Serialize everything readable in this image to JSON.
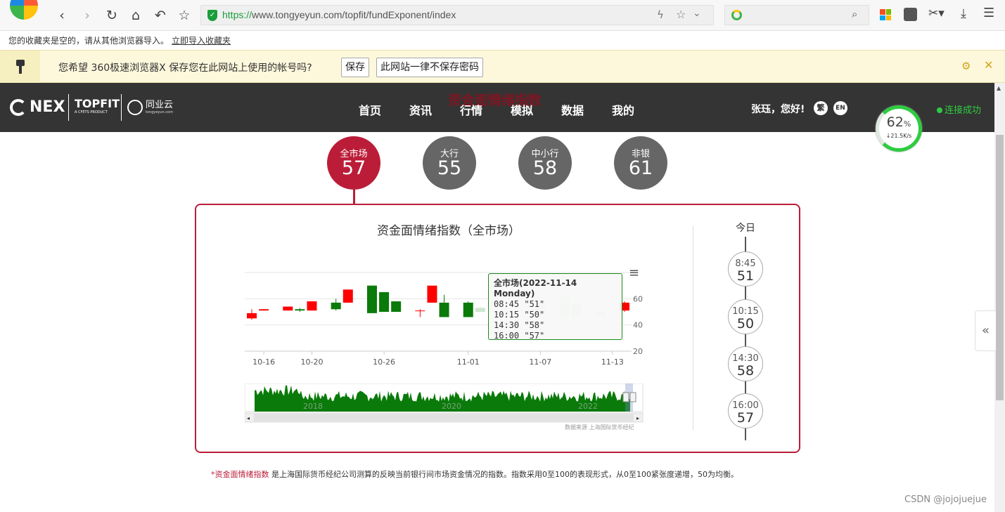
{
  "browser": {
    "url_scheme": "https://",
    "url_rest": "www.tongyeyun.com/topfit/fundExponent/index",
    "bookmark_empty_text": "您的收藏夹是空的，请从其他浏览器导入。",
    "bookmark_import_link": "立即导入收藏夹"
  },
  "password_bar": {
    "prompt": "您希望 360极速浏览器X 保存您在此网站上使用的帐号吗?",
    "save_label": "保存",
    "never_label": "此网站一律不保存密码"
  },
  "site": {
    "logo_nex": "NEX",
    "logo_topfit": "TOPFIT",
    "logo_topfit_sub": "A CFETS PRODUCT",
    "logo_tyy": "同业云",
    "logo_tyy_sub": "tongyeyun.com",
    "overlay_title": "资金面情绪指数",
    "nav": [
      "首页",
      "资讯",
      "行情",
      "模拟",
      "数据",
      "我的"
    ],
    "greeting": "张珏，您好!",
    "lang_trad": "繁",
    "lang_en": "EN",
    "connection": "连接成功",
    "speed_percent": "62",
    "speed_unit": "%",
    "speed_rate": "↓21.5K/s"
  },
  "circles": [
    {
      "label": "全市场",
      "value": "57",
      "active": true
    },
    {
      "label": "大行",
      "value": "55",
      "active": false
    },
    {
      "label": "中小行",
      "value": "58",
      "active": false
    },
    {
      "label": "非银",
      "value": "61",
      "active": false
    }
  ],
  "panel": {
    "chart_title": "资金面情绪指数（全市场）",
    "source_note": "数据来源 上海国际货币经纪",
    "today_label": "今日",
    "timeline": [
      {
        "time": "8:45",
        "value": "51"
      },
      {
        "time": "10:15",
        "value": "50"
      },
      {
        "time": "14:30",
        "value": "58"
      },
      {
        "time": "16:00",
        "value": "57"
      }
    ]
  },
  "tooltip": {
    "title": "全市场(2022-11-14 Monday)",
    "lines": [
      "08:45 \"51\"",
      "10:15 \"50\"",
      "14:30 \"58\"",
      "16:00 \"57\""
    ]
  },
  "footer": {
    "highlight": "资金面情绪指数",
    "text": " 是上海国际货币经纪公司测算的反映当前银行间市场资金情况的指数。指数采用0至100的表现形式，从0至100紧张度递增，50为均衡。"
  },
  "watermark": "CSDN @jojojuejue",
  "chart_data": {
    "type": "candlestick",
    "x_ticks": [
      "10-16",
      "10-20",
      "10-26",
      "11-01",
      "11-07",
      "11-13"
    ],
    "y_ticks": [
      20,
      40,
      60
    ],
    "ylim": [
      20,
      80
    ],
    "series": [
      {
        "date": "10-15",
        "open": 45,
        "close": 49,
        "high": 52,
        "low": 44
      },
      {
        "date": "10-16",
        "open": 51,
        "close": 52,
        "high": 52,
        "low": 51
      },
      {
        "date": "10-18",
        "open": 51,
        "close": 54,
        "high": 54,
        "low": 51
      },
      {
        "date": "10-19",
        "open": 52,
        "close": 51,
        "high": 53,
        "low": 50
      },
      {
        "date": "10-20",
        "open": 51,
        "close": 58,
        "high": 58,
        "low": 51
      },
      {
        "date": "10-22",
        "open": 57,
        "close": 52,
        "high": 60,
        "low": 51
      },
      {
        "date": "10-23",
        "open": 57,
        "close": 67,
        "high": 67,
        "low": 57
      },
      {
        "date": "10-25",
        "open": 70,
        "close": 49,
        "high": 70,
        "low": 49
      },
      {
        "date": "10-26",
        "open": 65,
        "close": 50,
        "high": 65,
        "low": 50
      },
      {
        "date": "10-27",
        "open": 58,
        "close": 50,
        "high": 58,
        "low": 50
      },
      {
        "date": "10-29",
        "open": 51,
        "close": 51,
        "high": 52,
        "low": 46
      },
      {
        "date": "10-30",
        "open": 57,
        "close": 70,
        "high": 70,
        "low": 57
      },
      {
        "date": "10-31",
        "open": 57,
        "close": 46,
        "high": 63,
        "low": 46
      },
      {
        "date": "11-01",
        "open": 57,
        "close": 46,
        "high": 58,
        "low": 46
      },
      {
        "date": "11-02",
        "open": 53,
        "close": 50,
        "high": 54,
        "low": 50
      },
      {
        "date": "11-04",
        "open": 51,
        "close": 51,
        "high": 52,
        "low": 50
      },
      {
        "date": "11-05",
        "open": 51,
        "close": 51,
        "high": 52,
        "low": 50
      },
      {
        "date": "11-07",
        "open": 57,
        "close": 47,
        "high": 57,
        "low": 47
      },
      {
        "date": "11-09",
        "open": 62,
        "close": 46,
        "high": 62,
        "low": 46
      },
      {
        "date": "11-10",
        "open": 56,
        "close": 46,
        "high": 56,
        "low": 46
      },
      {
        "date": "11-12",
        "open": 50,
        "close": 46,
        "high": 50,
        "low": 46
      },
      {
        "date": "11-14",
        "open": 51,
        "close": 57,
        "high": 58,
        "low": 50
      }
    ],
    "overview_labels": [
      "2018",
      "2020",
      "2022"
    ],
    "colors": {
      "up": "#ff0000",
      "down": "#0a7a0a"
    }
  }
}
